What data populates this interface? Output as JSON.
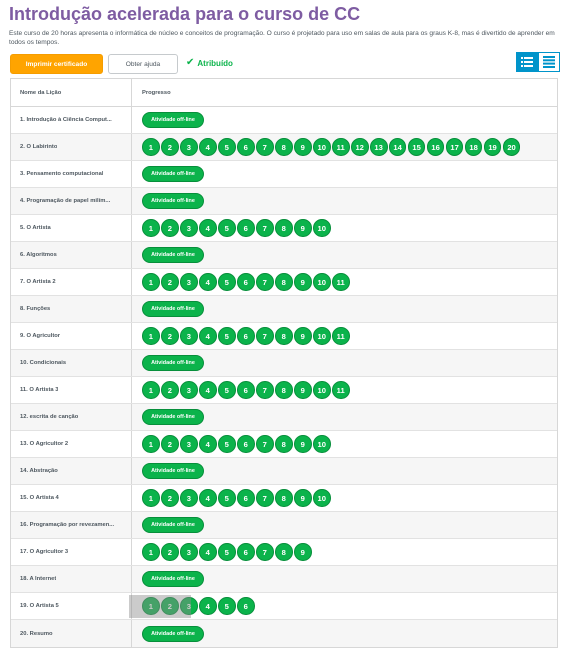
{
  "page": {
    "title": "Introdução acelerada para o curso de CC",
    "description": "Este curso de 20 horas apresenta o informática de núcleo e conceitos de programação. O curso é projetado para uso em salas de aula para os graus K-8, mas é divertido de aprender em todos os tempos."
  },
  "actions": {
    "print_label": "Imprimir certificado",
    "help_label": "Obter ajuda",
    "assigned_label": "Atribuído"
  },
  "colors": {
    "title": "#7e5ca2",
    "accent": "#ffa400",
    "success": "#0bb34b",
    "toggle": "#0094ca"
  },
  "icons": {
    "assigned": "check-icon",
    "list_view": "list-view-icon",
    "detail_view": "detail-view-icon"
  },
  "table": {
    "header_name": "Nome da Lição",
    "header_progress": "Progresso",
    "offline_label": "Atividade off-line",
    "lessons": [
      {
        "name": "1. Introdução à Ciência Comput...",
        "type": "offline"
      },
      {
        "name": "2. O Labirinto",
        "type": "levels",
        "levels": 20
      },
      {
        "name": "3. Pensamento computacional",
        "type": "offline"
      },
      {
        "name": "4. Programação de papel milím...",
        "type": "offline"
      },
      {
        "name": "5. O Artista",
        "type": "levels",
        "levels": 10
      },
      {
        "name": "6. Algoritmos",
        "type": "offline"
      },
      {
        "name": "7. O Artista 2",
        "type": "levels",
        "levels": 11
      },
      {
        "name": "8. Funções",
        "type": "offline"
      },
      {
        "name": "9. O Agricultor",
        "type": "levels",
        "levels": 11
      },
      {
        "name": "10. Condicionais",
        "type": "offline"
      },
      {
        "name": "11. O Artista 3",
        "type": "levels",
        "levels": 11
      },
      {
        "name": "12. escrita de canção",
        "type": "offline"
      },
      {
        "name": "13. O Agricultor 2",
        "type": "levels",
        "levels": 10
      },
      {
        "name": "14. Abstração",
        "type": "offline"
      },
      {
        "name": "15. O Artista 4",
        "type": "levels",
        "levels": 10
      },
      {
        "name": "16. Programação por revezamen...",
        "type": "offline"
      },
      {
        "name": "17. O Agricultor 3",
        "type": "levels",
        "levels": 9
      },
      {
        "name": "18. A Internet",
        "type": "offline"
      },
      {
        "name": "19. O Artista 5",
        "type": "levels",
        "levels": 6
      },
      {
        "name": "20. Resumo",
        "type": "offline"
      }
    ]
  }
}
